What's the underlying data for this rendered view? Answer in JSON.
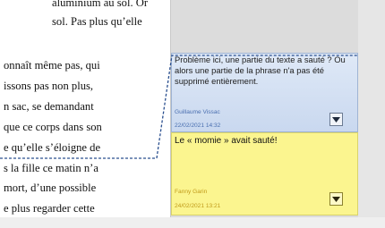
{
  "document": {
    "lines": [
      "aluminium au sol. Or",
      "sol.  Pas plus qu’elle",
      "onnaît même pas, qui",
      "issons pas non plus,",
      "n sac, se demandant",
      "que ce corps dans son",
      "e qu’elle s’éloigne de",
      "s la fille ce matin n’a",
      " mort, d’une possible",
      "e plus regarder cette"
    ]
  },
  "comments": [
    {
      "text": "Problème ici, une partie du texte a sauté ? Ou alors une partie de la phrase n'a pas été supprimé entièrement.",
      "author": "Guillaume Vissac",
      "date": "22/02/2021 14:32"
    },
    {
      "text": "Le « momie » avait sauté!",
      "author": "Fanny Garin",
      "date": "24/02/2021 13:21"
    }
  ],
  "colors": {
    "comment_1_bg": "#c9d8ef",
    "comment_2_bg": "#fbf58f",
    "anchor_line": "#2a4f8f"
  },
  "icons": {
    "comment_menu": "triangle-down-icon"
  }
}
